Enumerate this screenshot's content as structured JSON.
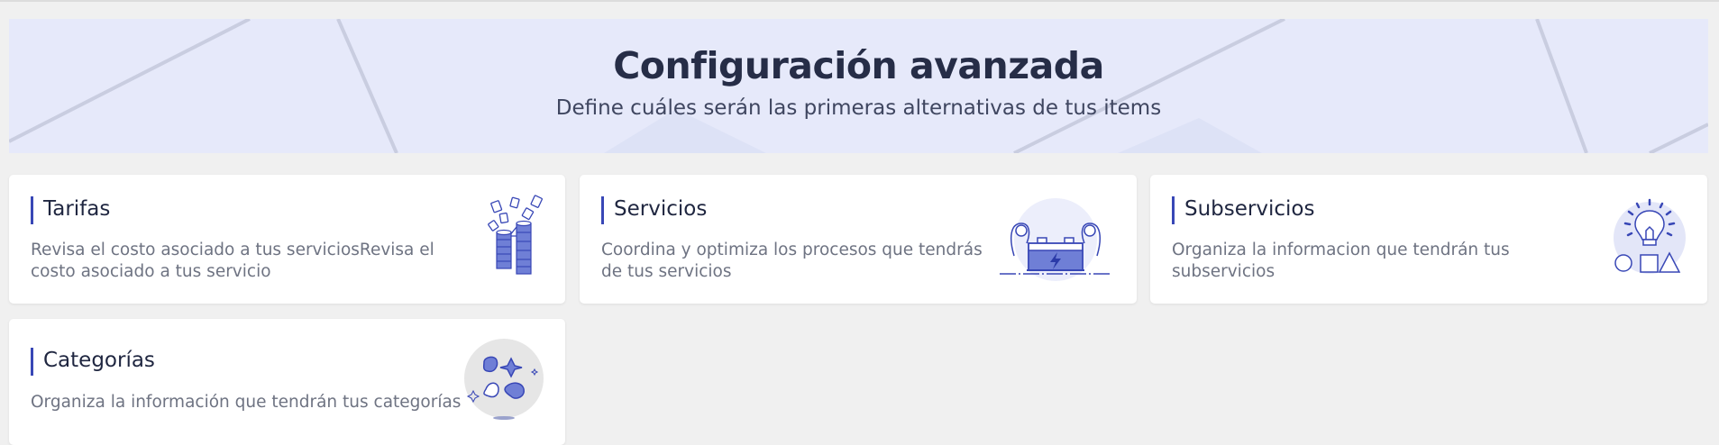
{
  "header": {
    "title": "Configuración avanzada",
    "subtitle": "Define cuáles serán las primeras alternativas de tus items"
  },
  "cards": [
    {
      "title": "Tarifas",
      "description": "Revisa el costo asociado a tus serviciosRevisa el costo asociado a tus servicio",
      "icon": "money-stacks-icon"
    },
    {
      "title": "Servicios",
      "description": "Coordina y optimiza los procesos que tendrás de tus servicios",
      "icon": "battery-icon"
    },
    {
      "title": "Subservicios",
      "description": "Organiza la informacion que tendrán tus subservicios",
      "icon": "lightbulb-shapes-icon"
    },
    {
      "title": "Categorías",
      "description": "Organiza la información que tendrán tus categorías",
      "icon": "shapes-icon"
    }
  ],
  "colors": {
    "accent": "#3847b6",
    "hero_background": "#e6e9fa",
    "page_background": "#f0f0f0",
    "title": "#262d47",
    "description": "#6e7382"
  }
}
